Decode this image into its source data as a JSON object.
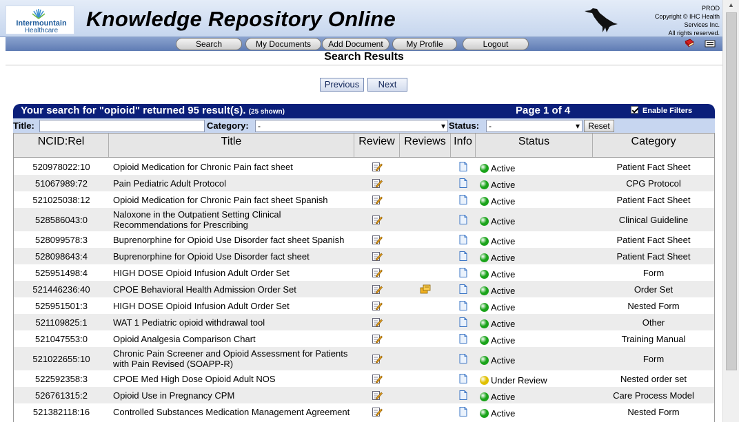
{
  "header": {
    "logo_line1": "Intermountain",
    "logo_line2": "Healthcare",
    "app_title": "Knowledge Repository Online",
    "env": "PROD",
    "copyright_line1": "Copyright © IHC Health",
    "copyright_line2": "Services Inc.",
    "copyright_line3": "All rights reserved."
  },
  "nav": {
    "items": [
      "Search",
      "My Documents",
      "Add Document",
      "My Profile",
      "Logout"
    ],
    "icons": [
      "book-icon",
      "print-icon"
    ]
  },
  "page_title": "Search Results",
  "pager": {
    "previous": "Previous",
    "next": "Next"
  },
  "results": {
    "summary": "Your search for \"opioid\" returned 95 result(s).",
    "shown": "(25 shown)",
    "page": "Page 1 of 4",
    "enable_filters_label": "Enable Filters",
    "enable_filters_checked": true
  },
  "filters": {
    "title_label": "Title:",
    "title_value": "",
    "category_label": "Category:",
    "category_value": "-",
    "status_label": "Status:",
    "status_value": "-",
    "reset_label": "Reset"
  },
  "table": {
    "columns": [
      "NCID:Rel",
      "Title",
      "Review",
      "Reviews",
      "Info",
      "Status",
      "Category"
    ],
    "colors": {
      "active": "#1aa31a",
      "under_review": "#e0c000",
      "row_alt": "#ececec"
    },
    "rows": [
      {
        "ncid": "520978022:10",
        "title": "Opioid Medication for Chronic Pain fact sheet",
        "status": "Active",
        "status_color": "active",
        "category": "Patient Fact Sheet",
        "has_reviews": false
      },
      {
        "ncid": "51067989:72",
        "title": "Pain Pediatric Adult Protocol",
        "status": "Active",
        "status_color": "active",
        "category": "CPG Protocol",
        "has_reviews": false
      },
      {
        "ncid": "521025038:12",
        "title": "Opioid Medication for Chronic Pain fact sheet Spanish",
        "status": "Active",
        "status_color": "active",
        "category": "Patient Fact Sheet",
        "has_reviews": false
      },
      {
        "ncid": "528586043:0",
        "title": "Naloxone in the Outpatient Setting Clinical Recommendations for Prescribing",
        "status": "Active",
        "status_color": "active",
        "category": "Clinical Guideline",
        "has_reviews": false
      },
      {
        "ncid": "528099578:3",
        "title": "Buprenorphine for Opioid Use Disorder fact sheet Spanish",
        "status": "Active",
        "status_color": "active",
        "category": "Patient Fact Sheet",
        "has_reviews": false
      },
      {
        "ncid": "528098643:4",
        "title": "Buprenorphine for Opioid Use Disorder fact sheet",
        "status": "Active",
        "status_color": "active",
        "category": "Patient Fact Sheet",
        "has_reviews": false
      },
      {
        "ncid": "525951498:4",
        "title": "HIGH DOSE Opioid Infusion Adult Order Set",
        "status": "Active",
        "status_color": "active",
        "category": "Form",
        "has_reviews": false
      },
      {
        "ncid": "521446236:40",
        "title": "CPOE Behavioral Health Admission Order Set",
        "status": "Active",
        "status_color": "active",
        "category": "Order Set",
        "has_reviews": true
      },
      {
        "ncid": "525951501:3",
        "title": "HIGH DOSE Opioid Infusion Adult Order Set",
        "status": "Active",
        "status_color": "active",
        "category": "Nested Form",
        "has_reviews": false
      },
      {
        "ncid": "521109825:1",
        "title": "WAT 1 Pediatric opioid withdrawal tool",
        "status": "Active",
        "status_color": "active",
        "category": "Other",
        "has_reviews": false
      },
      {
        "ncid": "521047553:0",
        "title": "Opioid Analgesia Comparison Chart",
        "status": "Active",
        "status_color": "active",
        "category": "Training Manual",
        "has_reviews": false
      },
      {
        "ncid": "521022655:10",
        "title": "Chronic Pain Screener and Opioid Assessment for Patients with Pain Revised (SOAPP-R)",
        "status": "Active",
        "status_color": "active",
        "category": "Form",
        "has_reviews": false
      },
      {
        "ncid": "522592358:3",
        "title": "CPOE Med High Dose Opioid Adult NOS",
        "status": "Under Review",
        "status_color": "under_review",
        "category": "Nested order set",
        "has_reviews": false
      },
      {
        "ncid": "526761315:2",
        "title": "Opioid Use in Pregnancy CPM",
        "status": "Active",
        "status_color": "active",
        "category": "Care Process Model",
        "has_reviews": false
      },
      {
        "ncid": "521382118:16",
        "title": "Controlled Substances Medication Management Agreement",
        "status": "Active",
        "status_color": "active",
        "category": "Nested Form",
        "has_reviews": false
      }
    ]
  }
}
